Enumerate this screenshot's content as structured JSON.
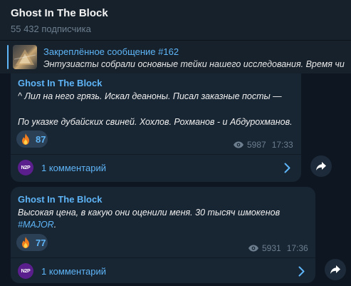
{
  "channel": {
    "title": "Ghost In The Block",
    "subscribers": "55 432 подписчика"
  },
  "pinned": {
    "title": "Закреплённое сообщение #162",
    "text": "Энтузиасты собрали основные тейки нашего исследования.   Время чи"
  },
  "messages": [
    {
      "author": "Ghost In The Block",
      "lines": [
        "^ Лил на него грязь. Искал деаноны. Писал заказные посты —",
        "По указке дубайских свиней. Хохлов. Рохманов - и Абдурохманов."
      ],
      "reaction": {
        "emoji": "fire-icon",
        "count": "87"
      },
      "views": "5987",
      "time": "17:33",
      "comments": {
        "avatar_text": "N2P",
        "label": "1 комментарий"
      }
    },
    {
      "author": "Ghost In The Block",
      "lines": [
        "Высокая цена, в какую они оценили меня. 30 тысяч шмокенов"
      ],
      "hashtag": "#MAJOR",
      "hashtag_suffix": ".",
      "reaction": {
        "emoji": "fire-icon",
        "count": "77"
      },
      "views": "5931",
      "time": "17:36",
      "comments": {
        "avatar_text": "N2P",
        "label": "1 комментарий"
      }
    }
  ],
  "colors": {
    "background": "#0e1621",
    "header": "#17212b",
    "bubble": "#182533",
    "accent": "#5eb5f7",
    "muted": "#6d7f8f",
    "reaction_bg": "#2b3f55"
  }
}
